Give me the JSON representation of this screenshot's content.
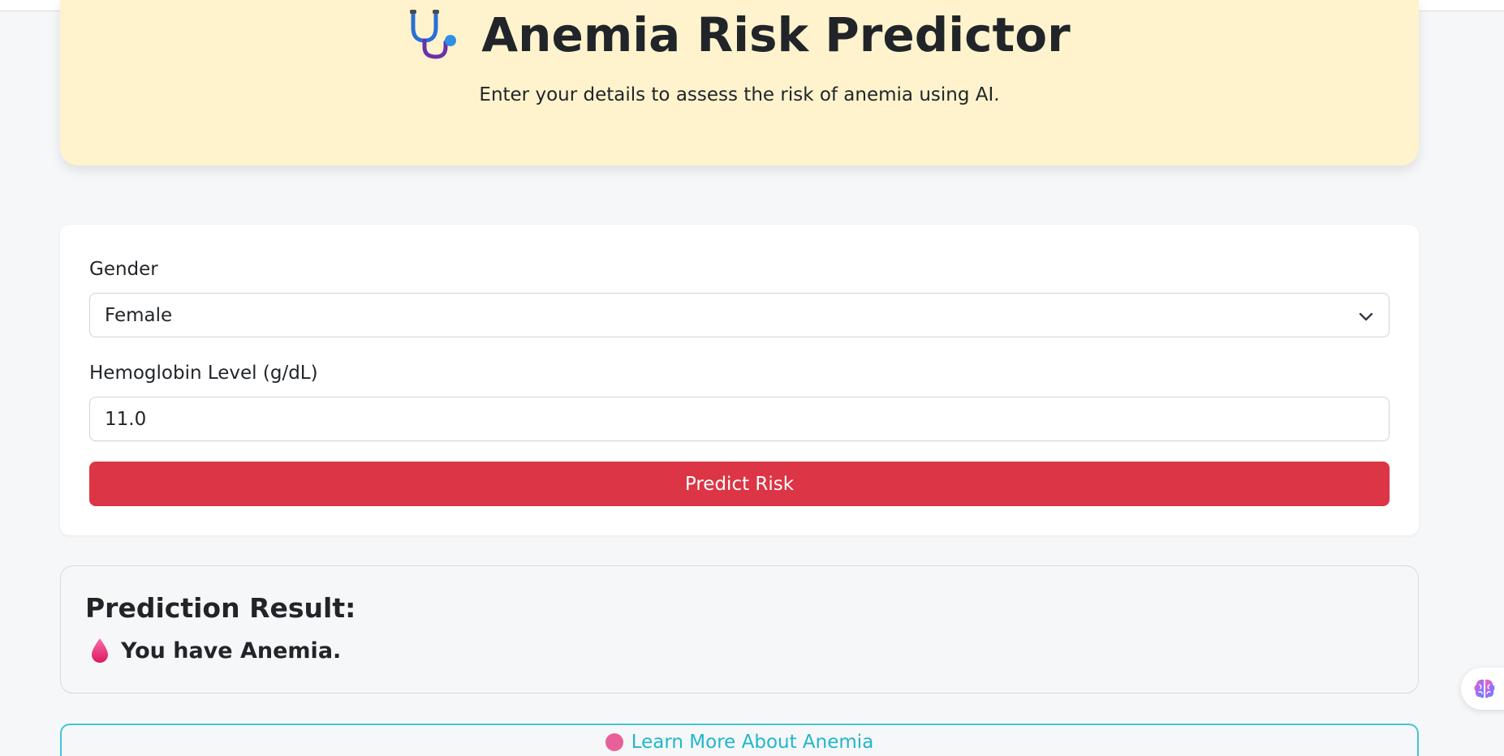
{
  "header": {
    "icon": "stethoscope-icon",
    "title": "Anemia Risk Predictor",
    "subtitle": "Enter your details to assess the risk of anemia using AI."
  },
  "form": {
    "gender_label": "Gender",
    "gender_value": "Female",
    "hemoglobin_label": "Hemoglobin Level (g/dL)",
    "hemoglobin_value": "11.0",
    "submit_label": "Predict Risk"
  },
  "result": {
    "title": "Prediction Result:",
    "icon": "blood-drop-icon",
    "message": "You have Anemia."
  },
  "learn_more": {
    "label": "Learn More About Anemia"
  },
  "colors": {
    "hero_bg": "#fff3cd",
    "primary_button": "#dc3545",
    "learn_border": "#45c4d6"
  }
}
